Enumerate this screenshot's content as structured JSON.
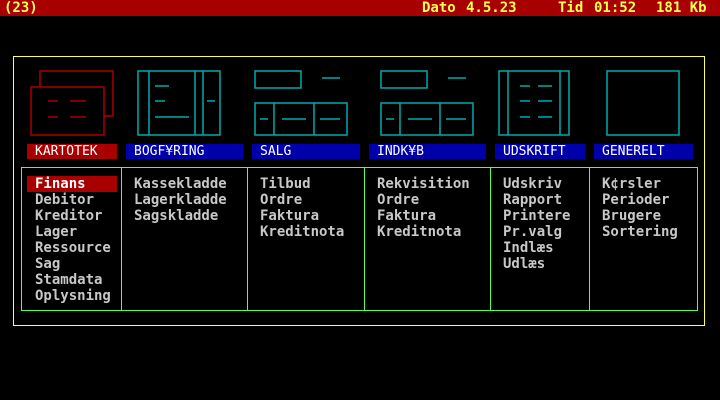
{
  "status": {
    "code": "(23)",
    "date_label": "Dato",
    "date": "4.5.23",
    "time_label": "Tid",
    "time": "01:52",
    "memory": "181 Kb"
  },
  "menus": [
    {
      "title": "KARTOTEK",
      "items": [
        "Finans",
        "Debitor",
        "Kreditor",
        "Lager",
        "Ressource",
        "Sag",
        "Stamdata",
        "Oplysning"
      ],
      "selected_item": "Finans"
    },
    {
      "title": "BOGF¥RING",
      "items": [
        "Kassekladde",
        "Lagerkladde",
        "Sagskladde"
      ]
    },
    {
      "title": "SALG",
      "items": [
        "Tilbud",
        "Ordre",
        "Faktura",
        "Kreditnota"
      ]
    },
    {
      "title": "INDK¥B",
      "items": [
        "Rekvisition",
        "Ordre",
        "Faktura",
        "Kreditnota"
      ]
    },
    {
      "title": "UDSKRIFT",
      "items": [
        "Udskriv",
        "Rapport",
        "Printere",
        "Pr.valg",
        "Indlæs",
        "Udlæs"
      ]
    },
    {
      "title": "GENERELT",
      "items": [
        "K¢rsler",
        "Perioder",
        "Brugere",
        "Sortering"
      ]
    }
  ],
  "active_menu": "KARTOTEK",
  "colors": {
    "status_bar": "#a80000",
    "status_text": "#ffff55",
    "frame": "#ffff55",
    "panel_border": "#55ff55",
    "icon_cyan": "#00aaaa",
    "icon_red": "#aa0000",
    "header_blue": "#0000aa",
    "header_active": "#a80000",
    "item_text": "#c8c8c8"
  },
  "icons": [
    "card-file-icon",
    "ledger-icon",
    "sales-form-icon",
    "purchase-form-icon",
    "report-icon",
    "general-blank-icon"
  ]
}
